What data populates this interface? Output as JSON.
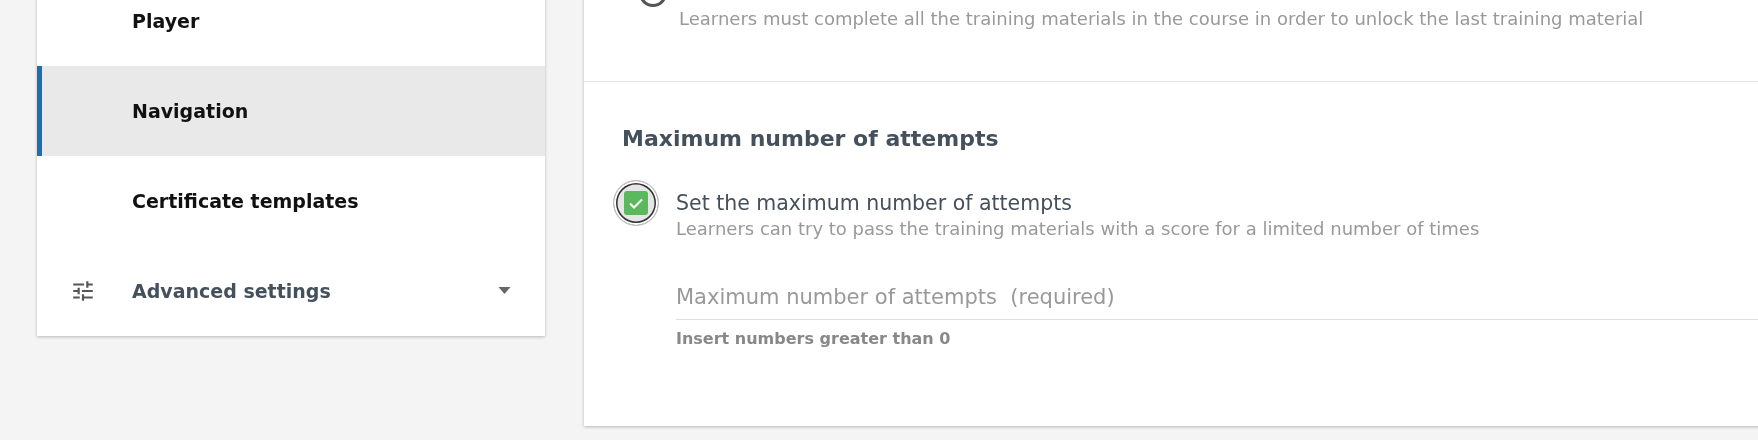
{
  "sidebar": {
    "items": [
      {
        "label": "Player",
        "selected": false,
        "kind": "link"
      },
      {
        "label": "Navigation",
        "selected": true,
        "kind": "link"
      },
      {
        "label": "Certificate templates",
        "selected": false,
        "kind": "link"
      },
      {
        "label": "Advanced settings",
        "selected": false,
        "kind": "group",
        "expanded": false
      }
    ]
  },
  "panel": {
    "top_option": {
      "description": "Learners must complete all the training materials in the course in order to unlock the last training material"
    },
    "section": {
      "title": "Maximum number of attempts",
      "option": {
        "label": "Set the maximum number of attempts",
        "description": "Learners can try to pass the training materials with a score for a limited number of times",
        "checked": true
      },
      "field": {
        "placeholder": "Maximum number of attempts  (required)",
        "helper": "Insert numbers greater than 0"
      }
    }
  }
}
